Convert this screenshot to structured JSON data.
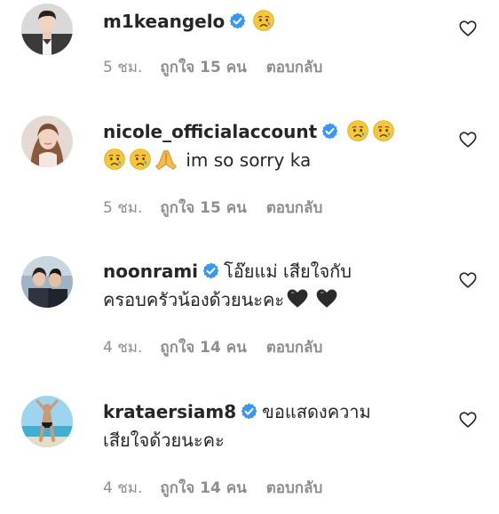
{
  "comments": [
    {
      "username": "m1keangelo",
      "text": "",
      "emojis": [
        "crying-face"
      ],
      "time": "5 ชม.",
      "likes": "ถูกใจ 15 คน",
      "reply": "ตอบกลับ"
    },
    {
      "username": "nicole_officialaccount",
      "text": "im so sorry ka",
      "emojis": [
        "crying-face",
        "crying-face",
        "crying-face",
        "crying-face",
        "folded-hands"
      ],
      "time": "5 ชม.",
      "likes": "ถูกใจ 15 คน",
      "reply": "ตอบกลับ"
    },
    {
      "username": "noonrami",
      "text_line1": "โอ๊ยแม่ เสียใจกับ",
      "text_line2": "ครอบครัวน้องด้วยนะคะ",
      "emojis": [
        "black-heart",
        "black-heart"
      ],
      "time": "4 ชม.",
      "likes": "ถูกใจ 14 คน",
      "reply": "ตอบกลับ"
    },
    {
      "username": "krataersiam8",
      "text_line1": "ขอแสดงความ",
      "text_line2": "เสียใจด้วยนะคะ",
      "time": "4 ชม.",
      "likes": "ถูกใจ 14 คน",
      "reply": "ตอบกลับ"
    }
  ],
  "colors": {
    "text": "#262626",
    "meta": "#8e8e8e",
    "verified": "#3897f0",
    "heart_outline": "#262626"
  },
  "icons": [
    "verified-badge-icon",
    "heart-outline-icon",
    "crying-face-emoji",
    "folded-hands-emoji",
    "black-heart-emoji"
  ]
}
